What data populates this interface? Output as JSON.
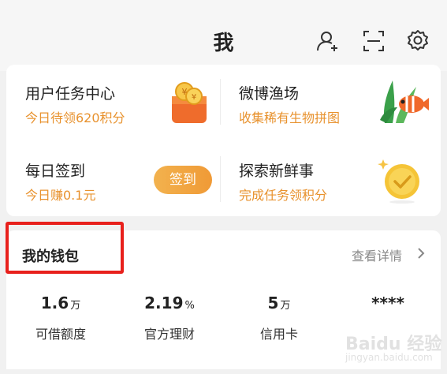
{
  "header": {
    "title": "我",
    "icons": [
      "add-friend-icon",
      "scan-icon",
      "settings-icon"
    ]
  },
  "tasks": [
    {
      "title": "用户任务中心",
      "subtitle": "今日待领620积分",
      "icon": "coin-bag-icon"
    },
    {
      "title": "微博渔场",
      "subtitle": "收集稀有生物拼图",
      "icon": "fish-icon"
    },
    {
      "title": "每日签到",
      "subtitle": "今日赚0.1元",
      "button": "签到"
    },
    {
      "title": "探索新鲜事",
      "subtitle": "完成任务领积分",
      "icon": "check-medal-icon"
    }
  ],
  "wallet": {
    "title": "我的钱包",
    "detail_link": "查看详情",
    "metrics": [
      {
        "value": "1.6",
        "unit": "万",
        "label": "可借额度"
      },
      {
        "value": "2.19",
        "unit": "%",
        "label": "官方理财"
      },
      {
        "value": "5",
        "unit": "万",
        "label": "信用卡"
      },
      {
        "value": "****",
        "unit": "",
        "label": ""
      }
    ]
  },
  "watermark": {
    "text": "Baidu 经验",
    "sub": "jingyan.baidu.com"
  },
  "colors": {
    "accent_orange": "#e8922e",
    "highlight_red": "#e8201c"
  }
}
